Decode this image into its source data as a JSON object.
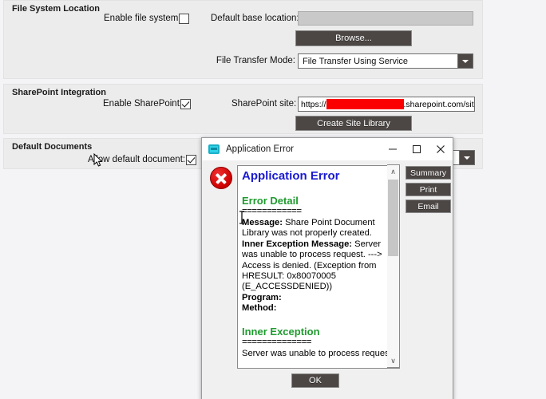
{
  "sections": {
    "file_system": {
      "title": "File System Location",
      "enable_label": "Enable file system:",
      "enable_checked": false,
      "base_location_label": "Default base location:",
      "base_location_value": "",
      "browse_label": "Browse...",
      "transfer_mode_label": "File Transfer Mode:",
      "transfer_mode_value": "File Transfer Using Service"
    },
    "sharepoint": {
      "title": "SharePoint Integration",
      "enable_label": "Enable SharePoint:",
      "enable_checked": true,
      "site_label": "SharePoint site:",
      "site_prefix": "https://",
      "site_redacted": true,
      "site_suffix": ".sharepoint.com/sites/",
      "create_library_label": "Create Site Library"
    },
    "default_documents": {
      "title": "Default Documents",
      "allow_label": "Allow default document:",
      "allow_checked": true
    }
  },
  "dialog": {
    "title": "Application Error",
    "icon": "application-window-icon",
    "minimize_label": "─",
    "maximize_label": "□",
    "close_label": "✕",
    "error_icon": "error-circle-icon",
    "heading": "Application Error",
    "section1_title": "Error Detail",
    "section1_rule": "============",
    "message_label": "Message:",
    "message_text": " Share Point Document Library was not properly created.",
    "inner_label": "Inner Exception Message:",
    "inner_text": " Server was unable to process request. ---> Access is denied. (Exception from HRESULT: 0x80070005 (E_ACCESSDENIED))",
    "program_label": "Program:",
    "method_label": "Method:",
    "section2_title": "Inner Exception",
    "section2_rule": "==============",
    "section2_text": "Server was unable to process request.",
    "buttons": {
      "summary": "Summary",
      "print": "Print",
      "email": "Email",
      "ok": "OK"
    },
    "scrollbar": {
      "up_arrow": "∧",
      "down_arrow": "∨"
    }
  },
  "colors": {
    "panel_bg": "#ececec",
    "page_bg": "#f4f4f6",
    "button_dark": "#4c4745",
    "redaction": "#fb0000",
    "heading_blue": "#1a1ad2",
    "heading_green": "#1f9b2f",
    "error_red": "#cc0000"
  }
}
